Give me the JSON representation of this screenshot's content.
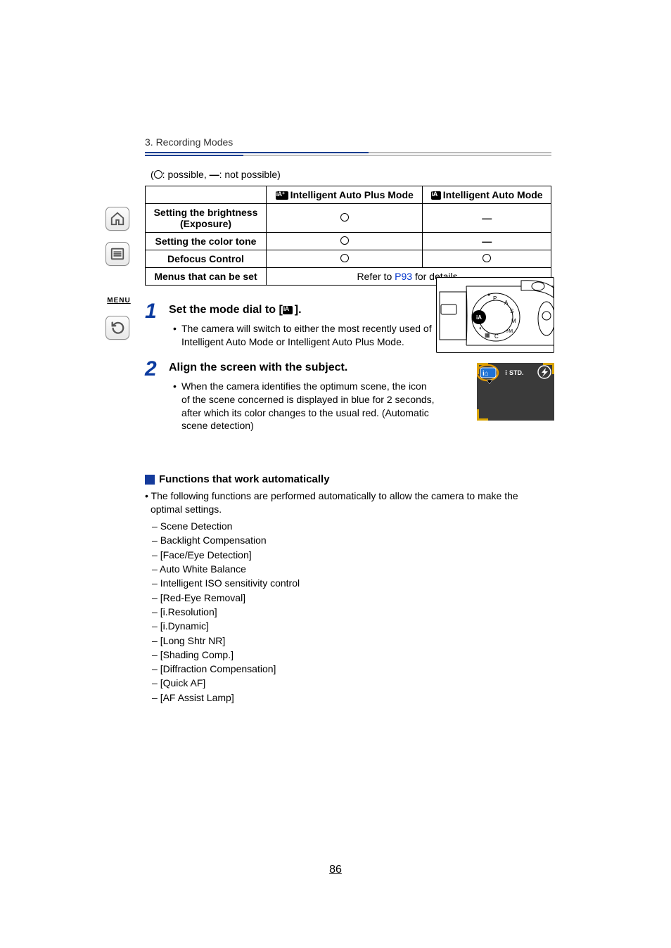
{
  "breadcrumb": "3. Recording Modes",
  "legend": "(○: possible, —: not possible)",
  "table": {
    "col1": "Intelligent Auto Plus Mode",
    "col2": "Intelligent Auto Mode",
    "rows": [
      {
        "label": "Setting the brightness (Exposure)",
        "c1": "○",
        "c2": "—"
      },
      {
        "label": "Setting the color tone",
        "c1": "○",
        "c2": "—"
      },
      {
        "label": "Defocus Control",
        "c1": "○",
        "c2": "○"
      }
    ],
    "menusRowLabel": "Menus that can be set",
    "menusRowTextA": "Refer to ",
    "menusRowLink": "P93",
    "menusRowTextB": " for details."
  },
  "step1": {
    "num": "1",
    "title_a": "Set the mode dial to [",
    "title_b": "].",
    "bullet": "The camera will switch to either the most recently used of Intelligent Auto Mode or Intelligent Auto Plus Mode."
  },
  "step2": {
    "num": "2",
    "title": "Align the screen with the subject.",
    "bullet": "When the camera identifies the optimum scene, the icon of the scene concerned is displayed in blue for 2 seconds, after which its color changes to the usual red. (Automatic scene detection)"
  },
  "autoSection": {
    "title": "Functions that work automatically",
    "intro": "The following functions are performed automatically to allow the camera to make the optimal settings.",
    "items": [
      "Scene Detection",
      "Backlight Compensation",
      "[Face/Eye Detection]",
      "Auto White Balance",
      "Intelligent ISO sensitivity control",
      "[Red-Eye Removal]",
      "[i.Resolution]",
      "[i.Dynamic]",
      "[Long Shtr NR]",
      "[Shading Comp.]",
      "[Diffraction Compensation]",
      "[Quick AF]",
      "[AF Assist Lamp]"
    ]
  },
  "pageNumber": "86",
  "sidenav": {
    "menuLabel": "MENU"
  },
  "icons": {
    "home": "home-icon",
    "toc": "toc-icon",
    "menu": "menu-icon",
    "back": "back-icon",
    "dial": "mode-dial-illustration",
    "screen": "screen-scene-illustration",
    "iaBadge": "ia-mode-icon",
    "iaPlusBadge": "ia-plus-mode-icon"
  },
  "fig2": {
    "std": "STD."
  }
}
